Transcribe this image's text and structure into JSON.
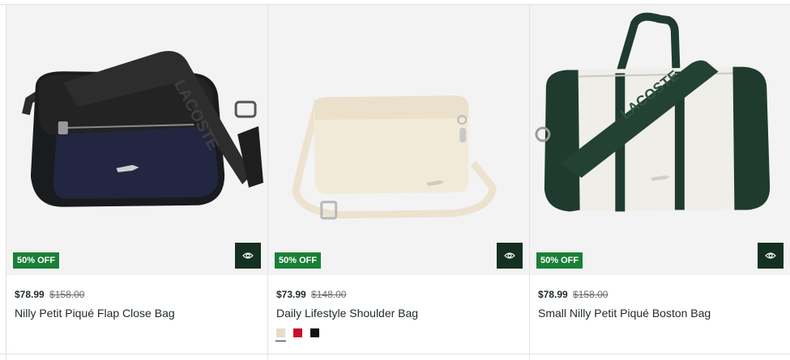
{
  "products": [
    {
      "badge": "50% OFF",
      "price_now": "$78.99",
      "price_was": "$158.00",
      "name": "Nilly Petit Piqué Flap Close Bag",
      "image_icon": "black-flap-crossbody-bag",
      "quickview_icon": "eye-icon",
      "strap_text": "LACOSTE",
      "swatches": []
    },
    {
      "badge": "50% OFF",
      "price_now": "$73.99",
      "price_was": "$148.00",
      "name": "Daily Lifestyle Shoulder Bag",
      "image_icon": "cream-shoulder-bag",
      "quickview_icon": "eye-icon",
      "swatches": [
        {
          "name": "cream",
          "color": "#e7dccb",
          "selected": true
        },
        {
          "name": "red",
          "color": "#c8102e",
          "selected": false
        },
        {
          "name": "black",
          "color": "#111111",
          "selected": false
        }
      ]
    },
    {
      "badge": "50% OFF",
      "price_now": "$78.99",
      "price_was": "$158.00",
      "name": "Small Nilly Petit Piqué Boston Bag",
      "image_icon": "white-green-boston-bag",
      "quickview_icon": "eye-icon",
      "strap_text": "LACOSTE",
      "swatches": []
    }
  ],
  "colors": {
    "badge": "#1a7f37",
    "quickview": "#133021",
    "image_bg": "#f3f3f3"
  }
}
